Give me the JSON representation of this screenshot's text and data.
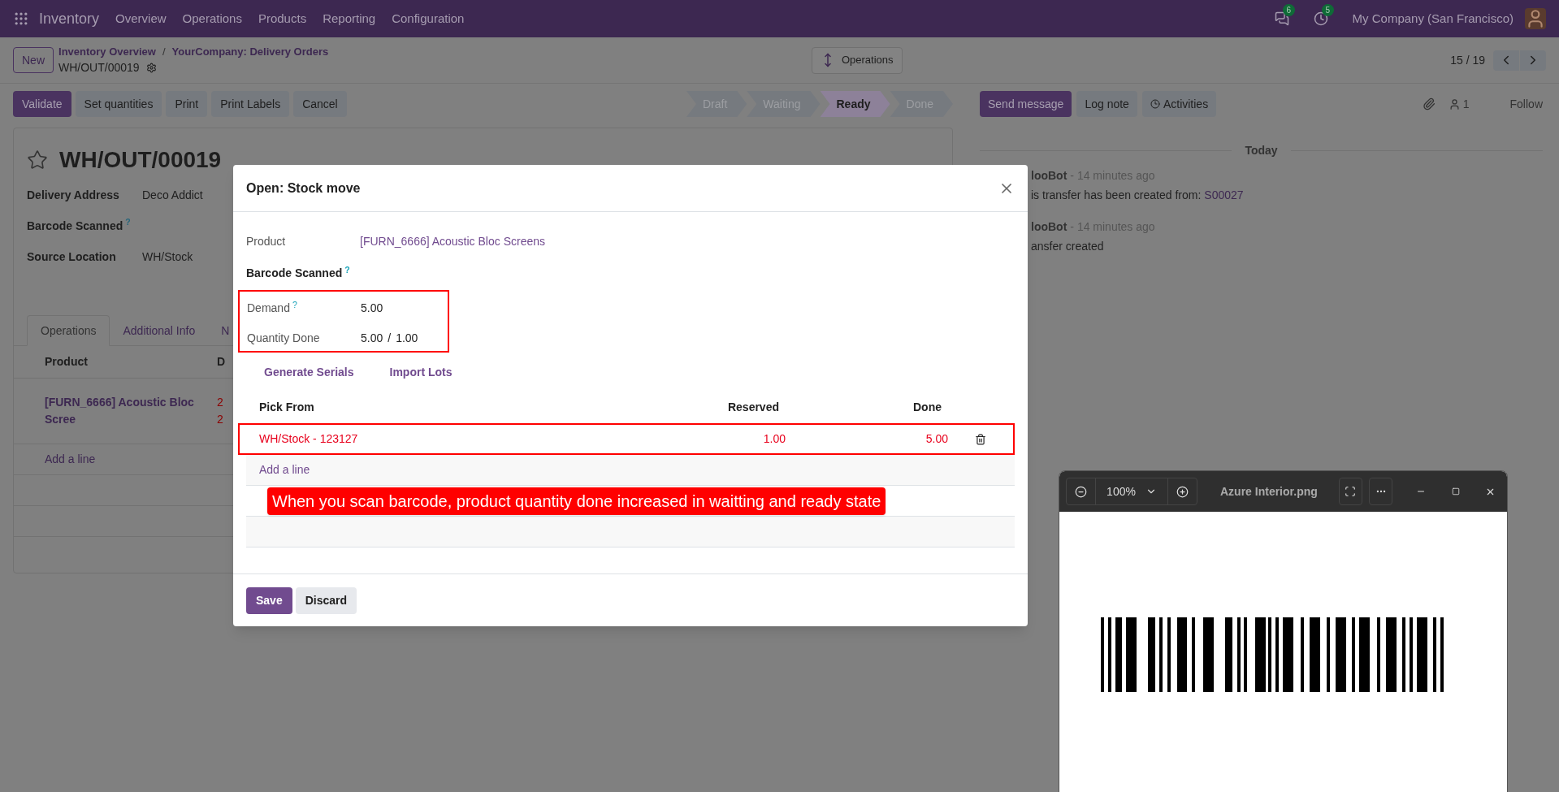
{
  "navbar": {
    "app": "Inventory",
    "menu": [
      "Overview",
      "Operations",
      "Products",
      "Reporting",
      "Configuration"
    ],
    "messages_count": "6",
    "activities_count": "5",
    "company": "My Company (San Francisco)"
  },
  "control_panel": {
    "new_button": "New",
    "breadcrumbs": [
      "Inventory Overview",
      "YourCompany: Delivery Orders"
    ],
    "breadcrumb_separator": "/",
    "record": "WH/OUT/00019",
    "center_button": "Operations",
    "pager": "15 / 19"
  },
  "actions": [
    {
      "label": "Validate",
      "kind": "primary"
    },
    {
      "label": "Set quantities",
      "kind": "secondary"
    },
    {
      "label": "Print",
      "kind": "secondary"
    },
    {
      "label": "Print Labels",
      "kind": "secondary"
    },
    {
      "label": "Cancel",
      "kind": "secondary"
    }
  ],
  "statusbar": [
    {
      "label": "Draft",
      "selected": false
    },
    {
      "label": "Waiting",
      "selected": false
    },
    {
      "label": "Ready",
      "selected": true
    },
    {
      "label": "Done",
      "selected": false
    }
  ],
  "chatter": {
    "buttons": [
      {
        "label": "Send message",
        "kind": "primary"
      },
      {
        "label": "Log note",
        "kind": "secondary"
      },
      {
        "label": "Activities",
        "kind": "secondary"
      }
    ],
    "followers": "1",
    "follow": "Follow",
    "date": "Today",
    "messages": [
      {
        "author": "looBot",
        "time": "- 14 minutes ago",
        "body": "is transfer has been created from:",
        "link": "S00027"
      },
      {
        "author": "looBot",
        "time": "- 14 minutes ago",
        "body": "ansfer created"
      }
    ]
  },
  "form": {
    "title": "WH/OUT/00019",
    "starred": false,
    "fields": [
      {
        "label": "Delivery Address",
        "value": "Deco Addict"
      },
      {
        "label": "Barcode Scanned",
        "help": "?"
      },
      {
        "label": "Source Location",
        "value": "WH/Stock"
      }
    ],
    "tabs": [
      {
        "label": "Operations",
        "selected": true
      },
      {
        "label": "Additional Info",
        "selected": false
      },
      {
        "label": "N",
        "selected": false
      }
    ],
    "table": {
      "columns": [
        "Product",
        "D"
      ],
      "rows": [
        {
          "product": "[FURN_6666] Acoustic Bloc Scree",
          "column_2": [
            "2",
            "2"
          ]
        }
      ],
      "add_line": "Add a line"
    }
  },
  "dialog": {
    "title": "Open: Stock move",
    "product": {
      "label": "Product",
      "value": "[FURN_6666] Acoustic Bloc Screens"
    },
    "barcode": {
      "label": "Barcode Scanned",
      "help": "?"
    },
    "quantities": {
      "highlighted": true,
      "demand": {
        "label": "Demand",
        "help": "?",
        "value": "5.00"
      },
      "done": {
        "label": "Quantity Done",
        "value": "5.00",
        "separator": "/",
        "total": "1.00"
      }
    },
    "links": [
      "Generate Serials",
      "Import Lots"
    ],
    "table": {
      "columns": [
        "Pick From",
        "Reserved",
        "Done"
      ],
      "rows": [
        {
          "location": "WH/Stock - 123127",
          "reserved": "1.00",
          "done": "5.00",
          "highlighted": true
        }
      ],
      "add_line": "Add a line"
    },
    "note": "When you scan barcode, product quantity done increased in waitting and ready state",
    "buttons": [
      {
        "label": "Save",
        "kind": "primary"
      },
      {
        "label": "Discard",
        "kind": "secondary"
      }
    ]
  },
  "image_viewer": {
    "zoom": "100%",
    "title": "Azure Interior.png"
  }
}
